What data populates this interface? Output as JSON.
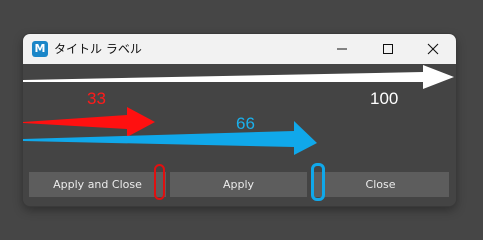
{
  "window": {
    "title": "タイトル ラベル",
    "app_icon_letter": "M"
  },
  "sliders": {
    "red_value": "33",
    "blue_value": "66",
    "white_value": "100",
    "colors": {
      "red": "#ff1a1a",
      "blue": "#1ab0ec",
      "white": "#ffffff"
    }
  },
  "buttons": {
    "apply_and_close": "Apply and Close",
    "apply": "Apply",
    "close": "Close"
  },
  "icons": {
    "minimize": "minimize-icon",
    "maximize": "maximize-icon",
    "close": "close-icon"
  }
}
